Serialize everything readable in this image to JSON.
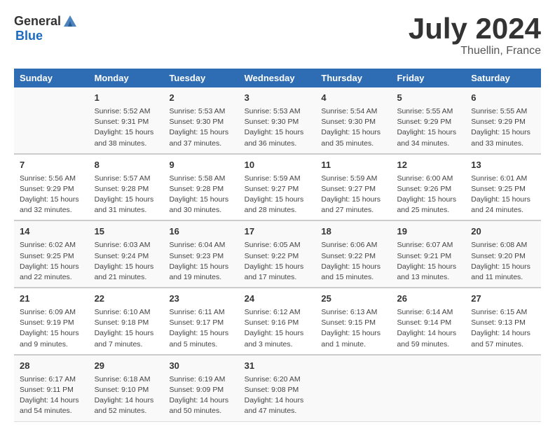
{
  "header": {
    "logo_general": "General",
    "logo_blue": "Blue",
    "title": "July 2024",
    "subtitle": "Thuellin, France"
  },
  "columns": [
    "Sunday",
    "Monday",
    "Tuesday",
    "Wednesday",
    "Thursday",
    "Friday",
    "Saturday"
  ],
  "weeks": [
    [
      {
        "day": "",
        "sunrise": "",
        "sunset": "",
        "daylight": ""
      },
      {
        "day": "1",
        "sunrise": "Sunrise: 5:52 AM",
        "sunset": "Sunset: 9:31 PM",
        "daylight": "Daylight: 15 hours and 38 minutes."
      },
      {
        "day": "2",
        "sunrise": "Sunrise: 5:53 AM",
        "sunset": "Sunset: 9:30 PM",
        "daylight": "Daylight: 15 hours and 37 minutes."
      },
      {
        "day": "3",
        "sunrise": "Sunrise: 5:53 AM",
        "sunset": "Sunset: 9:30 PM",
        "daylight": "Daylight: 15 hours and 36 minutes."
      },
      {
        "day": "4",
        "sunrise": "Sunrise: 5:54 AM",
        "sunset": "Sunset: 9:30 PM",
        "daylight": "Daylight: 15 hours and 35 minutes."
      },
      {
        "day": "5",
        "sunrise": "Sunrise: 5:55 AM",
        "sunset": "Sunset: 9:29 PM",
        "daylight": "Daylight: 15 hours and 34 minutes."
      },
      {
        "day": "6",
        "sunrise": "Sunrise: 5:55 AM",
        "sunset": "Sunset: 9:29 PM",
        "daylight": "Daylight: 15 hours and 33 minutes."
      }
    ],
    [
      {
        "day": "7",
        "sunrise": "Sunrise: 5:56 AM",
        "sunset": "Sunset: 9:29 PM",
        "daylight": "Daylight: 15 hours and 32 minutes."
      },
      {
        "day": "8",
        "sunrise": "Sunrise: 5:57 AM",
        "sunset": "Sunset: 9:28 PM",
        "daylight": "Daylight: 15 hours and 31 minutes."
      },
      {
        "day": "9",
        "sunrise": "Sunrise: 5:58 AM",
        "sunset": "Sunset: 9:28 PM",
        "daylight": "Daylight: 15 hours and 30 minutes."
      },
      {
        "day": "10",
        "sunrise": "Sunrise: 5:59 AM",
        "sunset": "Sunset: 9:27 PM",
        "daylight": "Daylight: 15 hours and 28 minutes."
      },
      {
        "day": "11",
        "sunrise": "Sunrise: 5:59 AM",
        "sunset": "Sunset: 9:27 PM",
        "daylight": "Daylight: 15 hours and 27 minutes."
      },
      {
        "day": "12",
        "sunrise": "Sunrise: 6:00 AM",
        "sunset": "Sunset: 9:26 PM",
        "daylight": "Daylight: 15 hours and 25 minutes."
      },
      {
        "day": "13",
        "sunrise": "Sunrise: 6:01 AM",
        "sunset": "Sunset: 9:25 PM",
        "daylight": "Daylight: 15 hours and 24 minutes."
      }
    ],
    [
      {
        "day": "14",
        "sunrise": "Sunrise: 6:02 AM",
        "sunset": "Sunset: 9:25 PM",
        "daylight": "Daylight: 15 hours and 22 minutes."
      },
      {
        "day": "15",
        "sunrise": "Sunrise: 6:03 AM",
        "sunset": "Sunset: 9:24 PM",
        "daylight": "Daylight: 15 hours and 21 minutes."
      },
      {
        "day": "16",
        "sunrise": "Sunrise: 6:04 AM",
        "sunset": "Sunset: 9:23 PM",
        "daylight": "Daylight: 15 hours and 19 minutes."
      },
      {
        "day": "17",
        "sunrise": "Sunrise: 6:05 AM",
        "sunset": "Sunset: 9:22 PM",
        "daylight": "Daylight: 15 hours and 17 minutes."
      },
      {
        "day": "18",
        "sunrise": "Sunrise: 6:06 AM",
        "sunset": "Sunset: 9:22 PM",
        "daylight": "Daylight: 15 hours and 15 minutes."
      },
      {
        "day": "19",
        "sunrise": "Sunrise: 6:07 AM",
        "sunset": "Sunset: 9:21 PM",
        "daylight": "Daylight: 15 hours and 13 minutes."
      },
      {
        "day": "20",
        "sunrise": "Sunrise: 6:08 AM",
        "sunset": "Sunset: 9:20 PM",
        "daylight": "Daylight: 15 hours and 11 minutes."
      }
    ],
    [
      {
        "day": "21",
        "sunrise": "Sunrise: 6:09 AM",
        "sunset": "Sunset: 9:19 PM",
        "daylight": "Daylight: 15 hours and 9 minutes."
      },
      {
        "day": "22",
        "sunrise": "Sunrise: 6:10 AM",
        "sunset": "Sunset: 9:18 PM",
        "daylight": "Daylight: 15 hours and 7 minutes."
      },
      {
        "day": "23",
        "sunrise": "Sunrise: 6:11 AM",
        "sunset": "Sunset: 9:17 PM",
        "daylight": "Daylight: 15 hours and 5 minutes."
      },
      {
        "day": "24",
        "sunrise": "Sunrise: 6:12 AM",
        "sunset": "Sunset: 9:16 PM",
        "daylight": "Daylight: 15 hours and 3 minutes."
      },
      {
        "day": "25",
        "sunrise": "Sunrise: 6:13 AM",
        "sunset": "Sunset: 9:15 PM",
        "daylight": "Daylight: 15 hours and 1 minute."
      },
      {
        "day": "26",
        "sunrise": "Sunrise: 6:14 AM",
        "sunset": "Sunset: 9:14 PM",
        "daylight": "Daylight: 14 hours and 59 minutes."
      },
      {
        "day": "27",
        "sunrise": "Sunrise: 6:15 AM",
        "sunset": "Sunset: 9:13 PM",
        "daylight": "Daylight: 14 hours and 57 minutes."
      }
    ],
    [
      {
        "day": "28",
        "sunrise": "Sunrise: 6:17 AM",
        "sunset": "Sunset: 9:11 PM",
        "daylight": "Daylight: 14 hours and 54 minutes."
      },
      {
        "day": "29",
        "sunrise": "Sunrise: 6:18 AM",
        "sunset": "Sunset: 9:10 PM",
        "daylight": "Daylight: 14 hours and 52 minutes."
      },
      {
        "day": "30",
        "sunrise": "Sunrise: 6:19 AM",
        "sunset": "Sunset: 9:09 PM",
        "daylight": "Daylight: 14 hours and 50 minutes."
      },
      {
        "day": "31",
        "sunrise": "Sunrise: 6:20 AM",
        "sunset": "Sunset: 9:08 PM",
        "daylight": "Daylight: 14 hours and 47 minutes."
      },
      {
        "day": "",
        "sunrise": "",
        "sunset": "",
        "daylight": ""
      },
      {
        "day": "",
        "sunrise": "",
        "sunset": "",
        "daylight": ""
      },
      {
        "day": "",
        "sunrise": "",
        "sunset": "",
        "daylight": ""
      }
    ]
  ]
}
